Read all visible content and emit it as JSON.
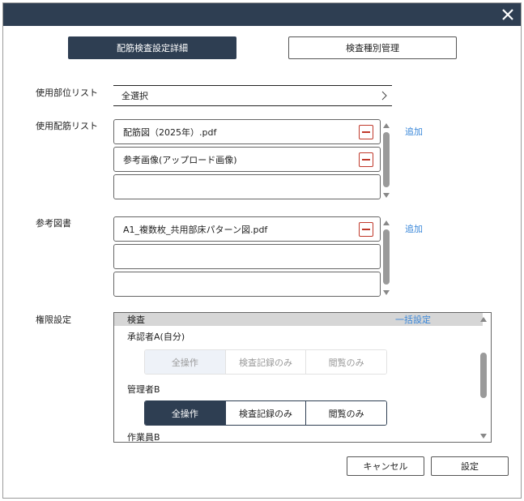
{
  "dialog": {
    "tabs": [
      {
        "label": "配筋検査設定詳細",
        "active": true
      },
      {
        "label": "検査種別管理",
        "active": false
      }
    ]
  },
  "sections": {
    "parts": {
      "label": "使用部位リスト",
      "value": "全選択"
    },
    "rebar": {
      "label": "使用配筋リスト",
      "files": [
        "配筋図（2025年）.pdf",
        "参考画像(アップロード画像)",
        ""
      ],
      "add_label": "追加"
    },
    "reference": {
      "label": "参考図書",
      "files": [
        "A1_複数枚_共用部床パターン図.pdf",
        "",
        ""
      ],
      "add_label": "追加"
    },
    "permissions": {
      "label": "権限設定",
      "header_title": "検査",
      "bulk_label": "一括設定",
      "users": [
        {
          "name": "承認者A(自分)",
          "options": [
            "全操作",
            "検査記録のみ",
            "閲覧のみ"
          ],
          "selected": "全操作",
          "disabled": true
        },
        {
          "name": "管理者B",
          "options": [
            "全操作",
            "検査記録のみ",
            "閲覧のみ"
          ],
          "selected": "全操作",
          "disabled": false
        },
        {
          "name": "作業員B"
        }
      ]
    }
  },
  "footer": {
    "cancel_label": "キャンセル",
    "confirm_label": "設定"
  },
  "colors": {
    "titlebar": "#2e3e52",
    "accent": "#2e3e52",
    "link": "#3a87d9",
    "remove": "#c0392b"
  },
  "icons": {
    "close": "close-icon",
    "chevron": "chevron-right-icon",
    "remove": "minus-icon"
  }
}
